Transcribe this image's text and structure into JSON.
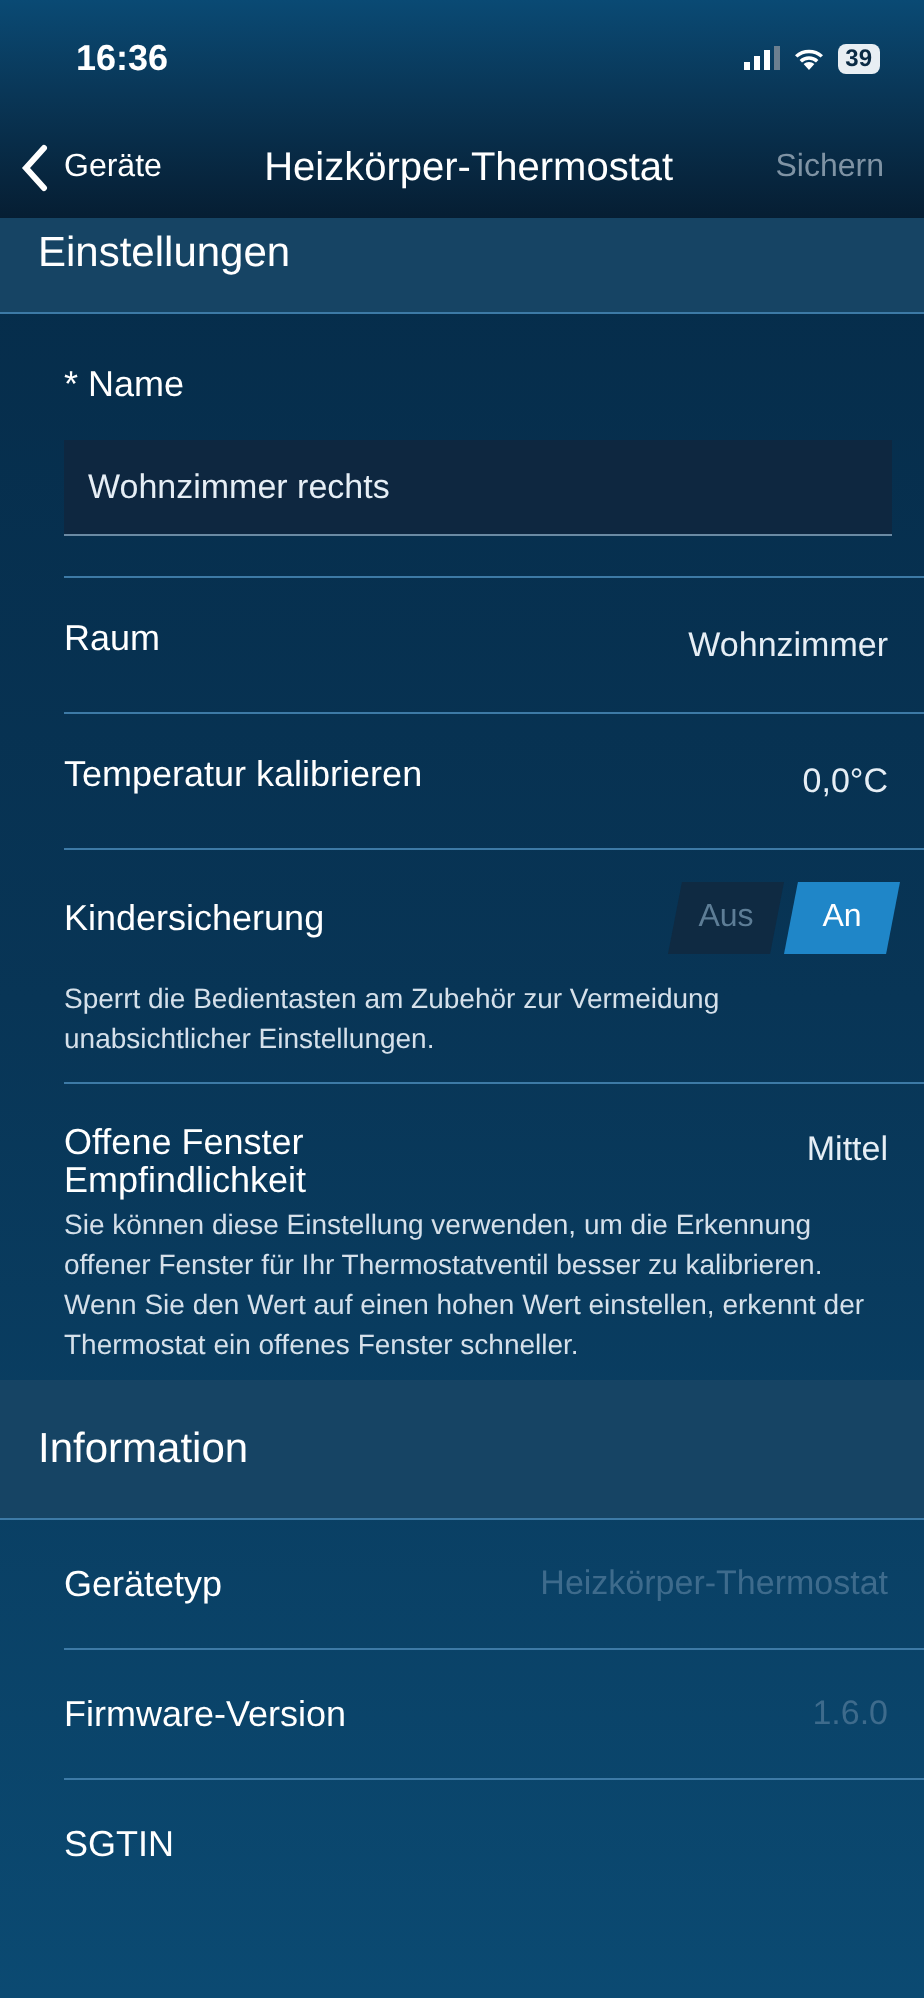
{
  "status_bar": {
    "time": "16:36",
    "battery": "39"
  },
  "nav": {
    "back": "Geräte",
    "title": "Heizkörper-Thermostat",
    "action": "Sichern",
    "action_disabled": true
  },
  "sections": [
    {
      "title": "Einstellungen",
      "items": [
        {
          "kind": "field",
          "label": "* Name",
          "value": "Wohnzimmer rechts"
        },
        {
          "kind": "value",
          "label": "Raum",
          "value": "Wohnzimmer"
        },
        {
          "kind": "value",
          "label": "Temperatur kalibrieren",
          "value": "0,0°C"
        },
        {
          "kind": "toggle",
          "label": "Kindersicherung",
          "options": [
            {
              "label": "Aus",
              "selected": false
            },
            {
              "label": "An",
              "selected": true
            }
          ],
          "description": "Sperrt die Bedientasten am Zubehör zur Vermeidung unabsichtlicher Einstellungen."
        },
        {
          "kind": "value",
          "label": "Offene Fenster Empfindlichkeit",
          "value": "Mittel",
          "description": "Sie können diese Einstellung verwenden, um die Erkennung offener Fenster für Ihr Thermostatventil besser zu kalibrieren. Wenn Sie den Wert auf einen hohen Wert einstellen, erkennt der Thermostat ein offenes Fenster schneller."
        }
      ]
    },
    {
      "title": "Information",
      "items": [
        {
          "kind": "info",
          "label": "Gerätetyp",
          "value": "Heizkörper-Thermostat"
        },
        {
          "kind": "info",
          "label": "Firmware-Version",
          "value": "1.6.0"
        },
        {
          "kind": "info",
          "label": "SGTIN"
        }
      ]
    }
  ]
}
